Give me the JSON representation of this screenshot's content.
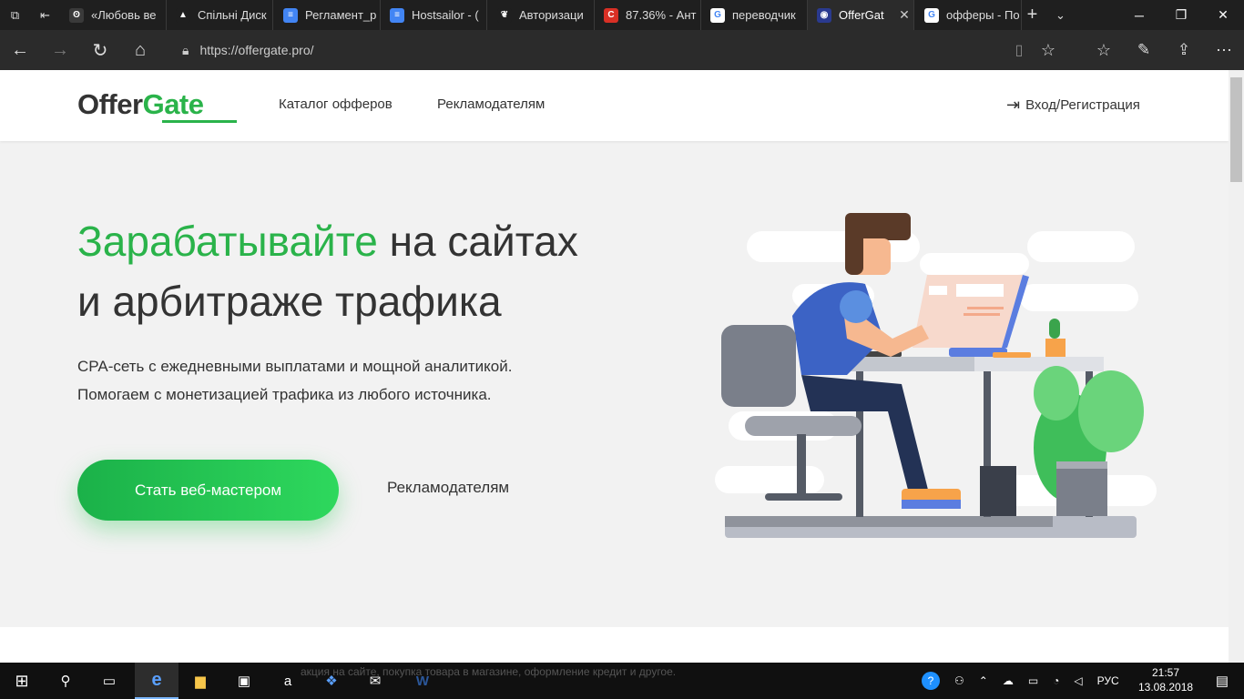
{
  "browser": {
    "tabs": [
      {
        "title": "«Любовь ве",
        "fav_bg": "#3a3a3a",
        "fav": "ʘ"
      },
      {
        "title": "Спільні Диск",
        "fav_bg": "#1f1f1f",
        "fav": "▲"
      },
      {
        "title": "Регламент_р",
        "fav_bg": "#4285f4",
        "fav": "≡"
      },
      {
        "title": "Hostsailor - (",
        "fav_bg": "#4285f4",
        "fav": "≡"
      },
      {
        "title": "Авторизаци",
        "fav_bg": "#1f1f1f",
        "fav": "❦"
      },
      {
        "title": "87.36% - Ант",
        "fav_bg": "#d93025",
        "fav": "C"
      },
      {
        "title": "переводчик",
        "fav_bg": "#ffffff",
        "fav": "G"
      },
      {
        "title": "OfferGat",
        "fav_bg": "#2a3a8f",
        "fav": "◉",
        "active": true
      },
      {
        "title": "офферы - По",
        "fav_bg": "#ffffff",
        "fav": "G"
      }
    ],
    "url": "https://offergate.pro/",
    "tab_close": "✕",
    "new_tab": "+",
    "tab_list": "⌄"
  },
  "site": {
    "logo_part1": "Offer",
    "logo_part2": "Gate",
    "nav_catalog": "Каталог офферов",
    "nav_advertisers": "Рекламодателям",
    "login": "Вход/Регистрация",
    "hero_title_green": "Зарабатывайте",
    "hero_title_rest1": " на сайтах",
    "hero_title_rest2": "и арбитраже трафика",
    "hero_sub1": "CPA-сеть с ежедневными выплатами и мощной аналитикой.",
    "hero_sub2": "Помогаем с монетизацией трафика из любого источника.",
    "btn_webmaster": "Стать веб-мастером",
    "btn_advertisers": "Рекламодателям"
  },
  "taskbar": {
    "bleed_text": "акция на сайте, покупка товара в магазине, оформление кредит и другое.",
    "lang": "РУС",
    "time": "21:57",
    "date": "13.08.2018"
  },
  "colors": {
    "accent": "#2ab34a",
    "text": "#333333",
    "hero_bg": "#f2f2f2"
  }
}
